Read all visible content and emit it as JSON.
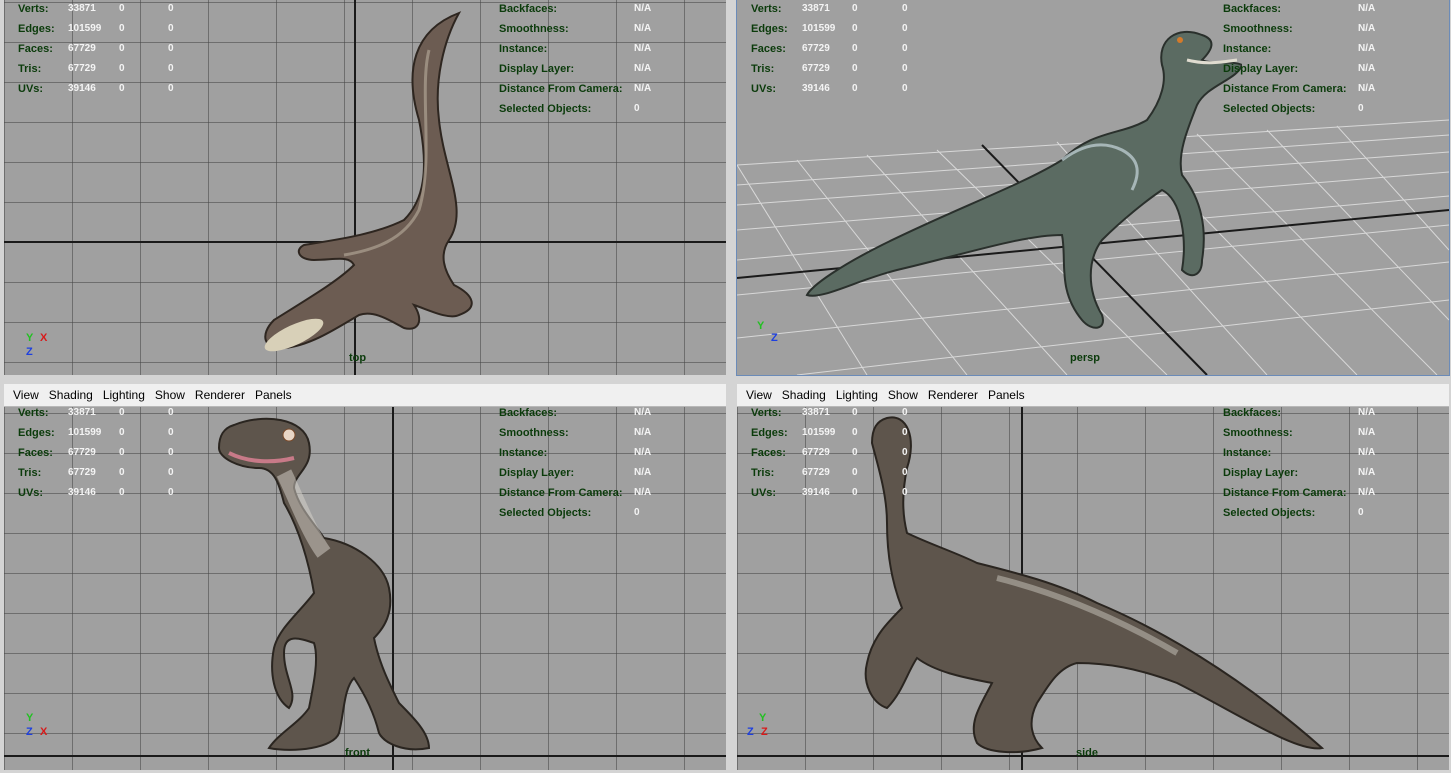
{
  "menu": [
    "View",
    "Shading",
    "Lighting",
    "Show",
    "Renderer",
    "Panels"
  ],
  "hud_left": {
    "rows": [
      {
        "label": "Verts:",
        "v1": "33871",
        "v2": "0",
        "v3": "0"
      },
      {
        "label": "Edges:",
        "v1": "101599",
        "v2": "0",
        "v3": "0"
      },
      {
        "label": "Faces:",
        "v1": "67729",
        "v2": "0",
        "v3": "0"
      },
      {
        "label": "Tris:",
        "v1": "67729",
        "v2": "0",
        "v3": "0"
      },
      {
        "label": "UVs:",
        "v1": "39146",
        "v2": "0",
        "v3": "0"
      }
    ]
  },
  "hud_right": {
    "rows": [
      {
        "label": "Backfaces:",
        "value": "N/A"
      },
      {
        "label": "Smoothness:",
        "value": "N/A"
      },
      {
        "label": "Instance:",
        "value": "N/A"
      },
      {
        "label": "Display Layer:",
        "value": "N/A"
      },
      {
        "label": "Distance From Camera:",
        "value": "N/A"
      },
      {
        "label": "Selected Objects:",
        "value": "0"
      }
    ]
  },
  "panels": [
    {
      "camera": "top",
      "axes": [
        "Y",
        "X",
        "Z"
      ]
    },
    {
      "camera": "persp",
      "axes": [
        "Y",
        "Z"
      ]
    },
    {
      "camera": "front",
      "axes": [
        "Y",
        "Z",
        "X"
      ]
    },
    {
      "camera": "side",
      "axes": [
        "Y",
        "Z",
        "Z"
      ]
    }
  ],
  "colors": {
    "hud_label": "#0b3b0b",
    "hud_value": "#f4f4f4",
    "viewport_bg": "#a0a0a0"
  }
}
